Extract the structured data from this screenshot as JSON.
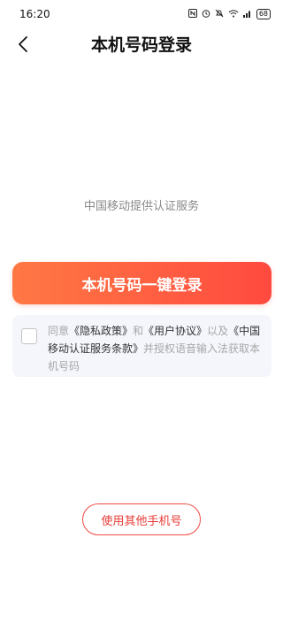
{
  "status_bar": {
    "time": "16:20",
    "battery": "68",
    "icons": [
      "nfc-icon",
      "alarm-icon",
      "mute-icon",
      "wifi-icon",
      "signal-icon",
      "battery-icon"
    ]
  },
  "header": {
    "title": "本机号码登录",
    "back_icon": "back-arrow-icon"
  },
  "carrier_text": "中国移动提供认证服务",
  "login_button": "本机号码一键登录",
  "agreement": {
    "checked": false,
    "prefix": "同意",
    "privacy_policy": "《隐私政策》",
    "and": "和",
    "user_agreement": "《用户协议》",
    "middle": "以及",
    "carrier_terms": "《中国移动认证服务条款》",
    "suffix": "并授权语音输入法获取本机号码"
  },
  "other_number_button": "使用其他手机号",
  "colors": {
    "accent_start": "#ff7844",
    "accent_end": "#ff4a3f",
    "outline_red": "#f04a44"
  }
}
